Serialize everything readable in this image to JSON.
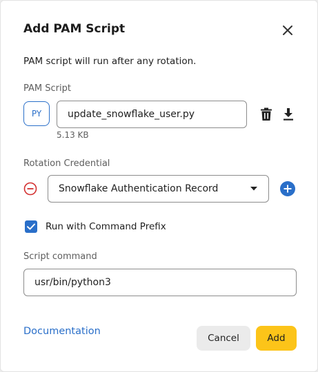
{
  "dialog": {
    "title": "Add PAM Script",
    "intro": "PAM script will run after any rotation."
  },
  "pam_script": {
    "label": "PAM Script",
    "badge": "PY",
    "file_name": "update_snowflake_user.py",
    "file_size": "5.13 KB"
  },
  "rotation": {
    "label": "Rotation Credential",
    "selected": "Snowflake Authentication Record"
  },
  "prefix": {
    "label": "Run with Command Prefix",
    "checked": true
  },
  "command": {
    "label": "Script command",
    "value": "usr/bin/python3"
  },
  "footer": {
    "doc_link": "Documentation",
    "cancel": "Cancel",
    "add": "Add"
  },
  "colors": {
    "accent": "#2a6fc9",
    "danger": "#d32f2f",
    "primary_button": "#fcc419"
  },
  "icons": [
    "close-icon",
    "trash-icon",
    "download-icon",
    "remove-circle-icon",
    "chevron-down-icon",
    "add-circle-icon",
    "check-icon"
  ]
}
